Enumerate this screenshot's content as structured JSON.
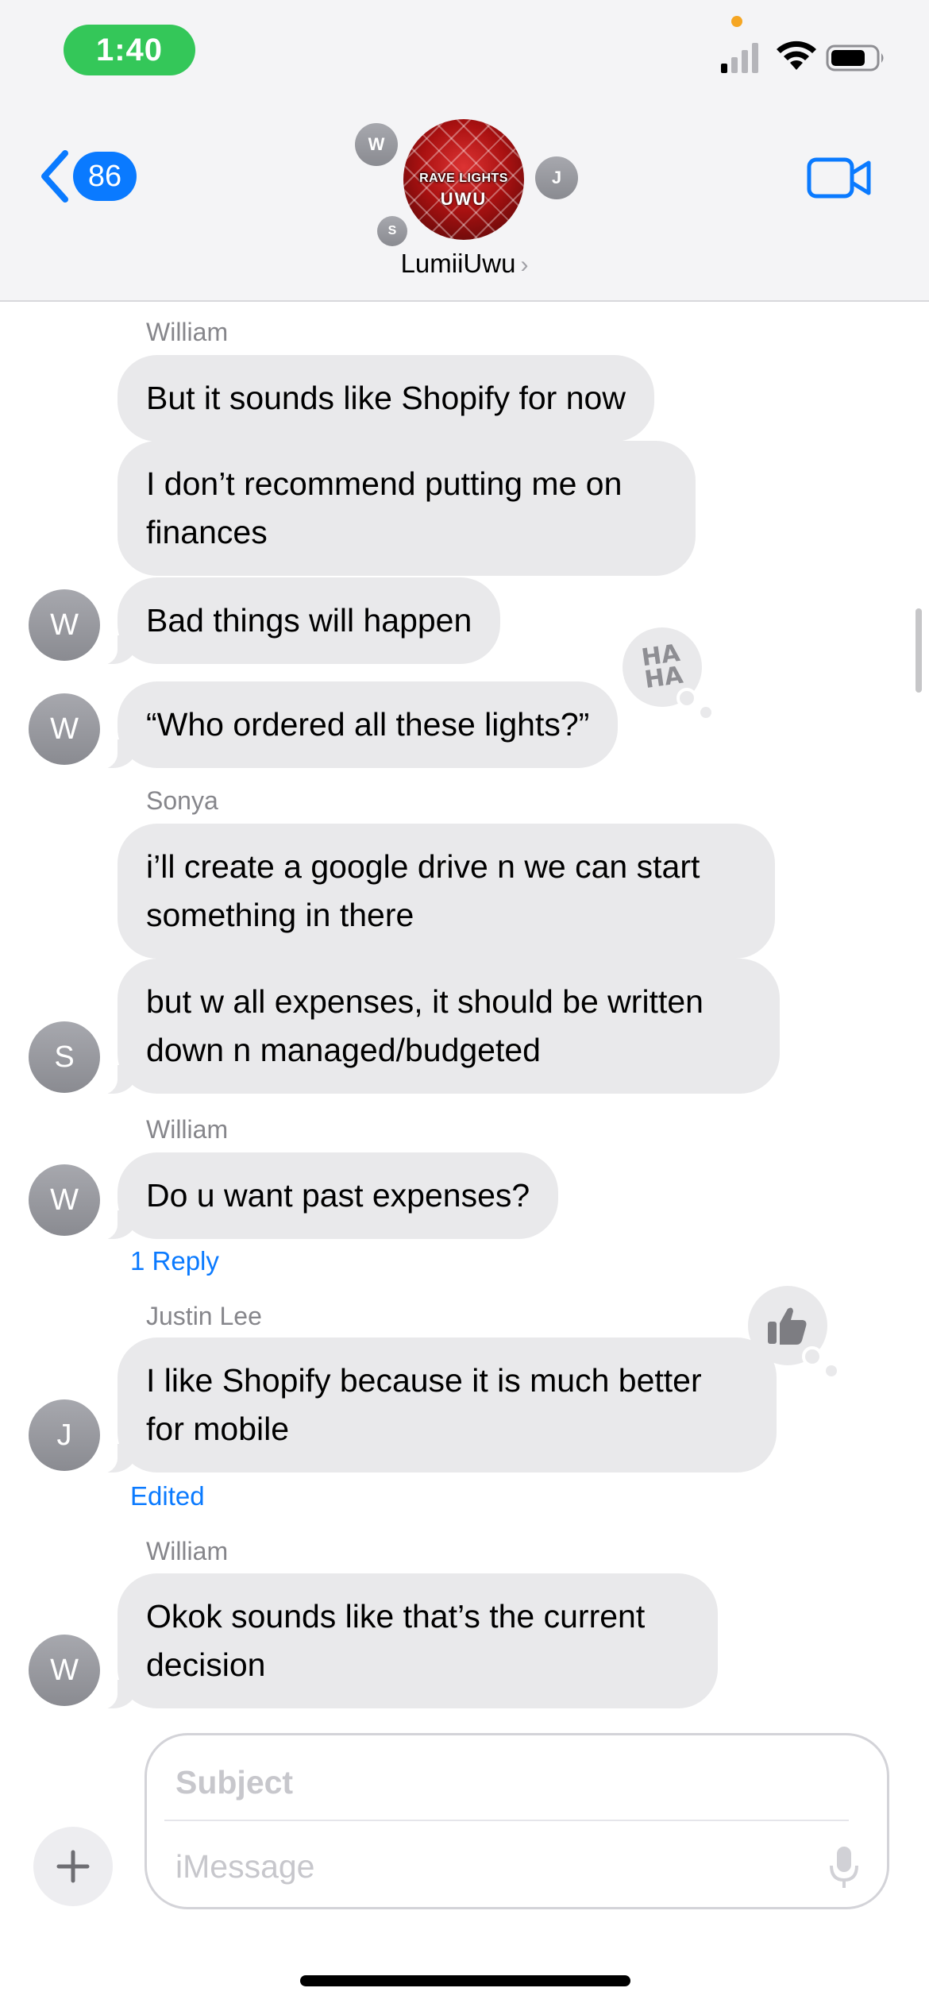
{
  "status_bar": {
    "time": "1:40"
  },
  "header": {
    "back_count": "86",
    "group_name": "LumiiUwu",
    "group_avatar_text_top": "RAVE LIGHTS",
    "group_avatar_text_bottom": "UWU",
    "member_initials": [
      "W",
      "J",
      "S"
    ]
  },
  "messages": [
    {
      "sender": "William",
      "text": "But it sounds like Shopify for now"
    },
    {
      "text": "I don’t recommend putting me on finances"
    },
    {
      "text": "Bad things will happen",
      "avatar": "W"
    },
    {
      "text": "“Who ordered all these lights?”",
      "avatar": "W",
      "tapback": "haha"
    },
    {
      "sender": "Sonya",
      "text": "i’ll create a google drive n we can start something in there"
    },
    {
      "text": "but w all expenses, it should be written down n managed/budgeted",
      "avatar": "S"
    },
    {
      "sender": "William",
      "text": "Do u want past expenses?",
      "avatar": "W",
      "footer": "1 Reply"
    },
    {
      "sender": "Justin Lee",
      "text": "I like Shopify because it is much better for mobile",
      "avatar": "J",
      "tapback": "thumbs-up",
      "footer": "Edited"
    },
    {
      "sender": "William",
      "text": "Okok sounds like that’s the current decision",
      "avatar": "W"
    }
  ],
  "tapbacks": {
    "haha_line1": "HA",
    "haha_line2": "HA"
  },
  "composer": {
    "subject_placeholder": "Subject",
    "message_placeholder": "iMessage"
  },
  "colors": {
    "accent": "#0a7aff",
    "bubble_received": "#e9e9eb",
    "time_pill": "#34c759"
  }
}
